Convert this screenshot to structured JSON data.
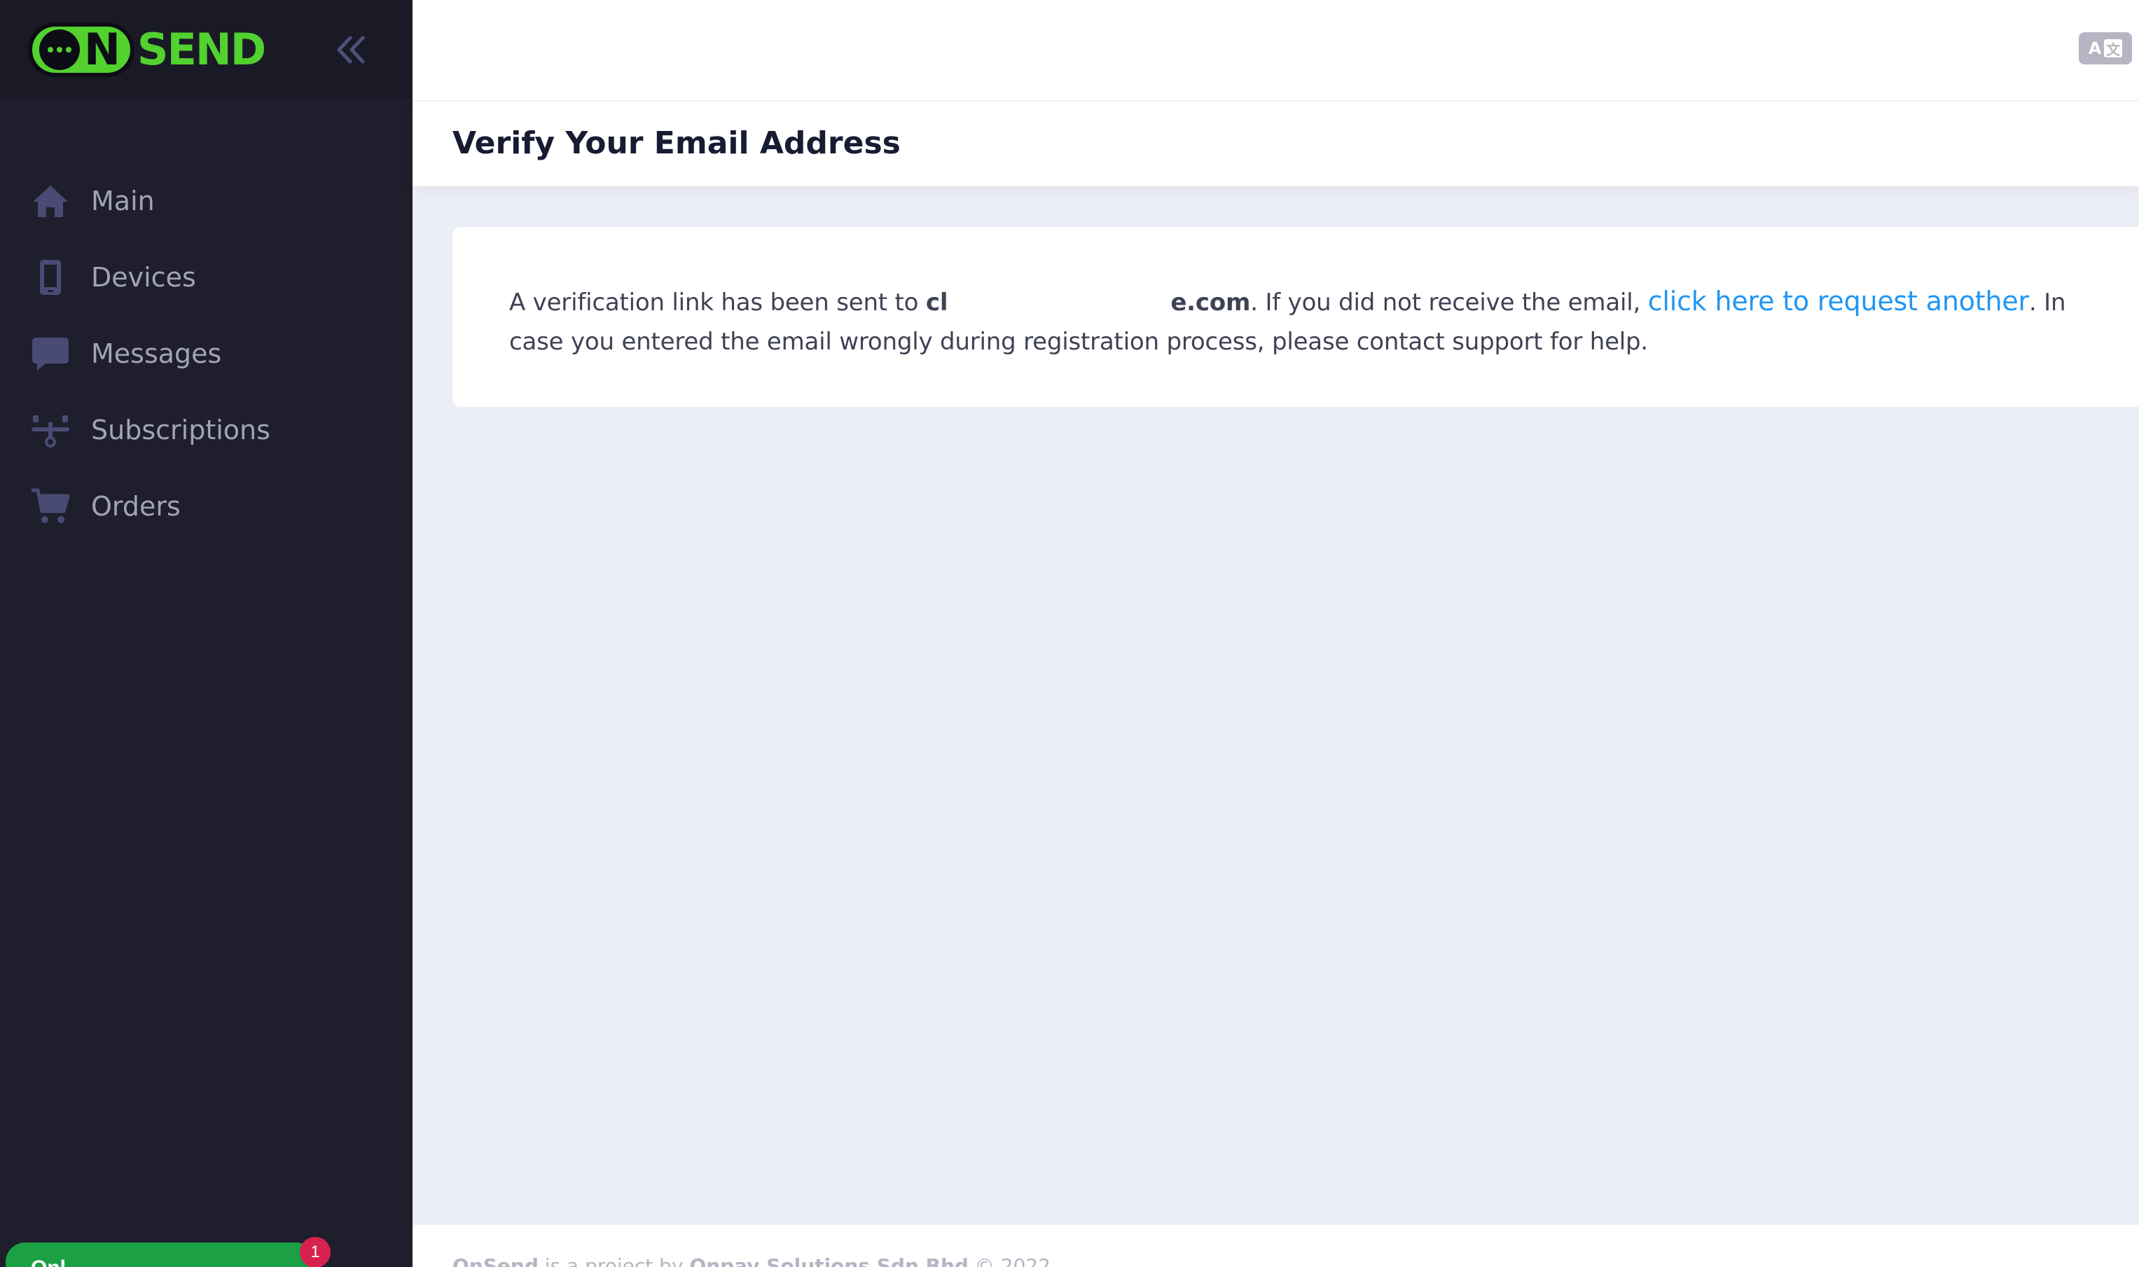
{
  "app": {
    "logo_text_o": "O",
    "logo_text_n": "N",
    "logo_text_rest": "SEND",
    "brand_color": "#52d12f",
    "sidebar_color": "#1e1e2d",
    "link_color": "#2196f3"
  },
  "sidebar": {
    "items": [
      {
        "label": "Main",
        "icon": "home-icon"
      },
      {
        "label": "Devices",
        "icon": "phone-icon"
      },
      {
        "label": "Messages",
        "icon": "chat-bubble-icon"
      },
      {
        "label": "Subscriptions",
        "icon": "network-icon"
      },
      {
        "label": "Orders",
        "icon": "cart-icon"
      }
    ],
    "status_label": "Onl",
    "status_badge": "1"
  },
  "header": {
    "translate_a": "A",
    "translate_z": "文"
  },
  "page": {
    "title": "Verify Your Email Address",
    "message_part1": "A verification link has been sent to ",
    "email_prefix": "cl",
    "email_suffix": "e.com",
    "message_part2": ". If you did not receive the email, ",
    "request_link": "click here to request another",
    "message_part3": ". In case you entered the email wrongly during registration process, please contact support for help."
  },
  "footer": {
    "brand": "OnSend",
    "text1": " is a project by ",
    "company": "Onpay Solutions Sdn Bhd",
    "text2": " © 2022"
  }
}
